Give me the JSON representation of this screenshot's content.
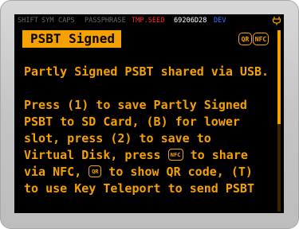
{
  "status_bar": {
    "shift": "SHIFT",
    "sym": "SYM",
    "caps": "CAPS",
    "passphrase": "PASSPHRASE",
    "tmp_seed": "TMP.SEED",
    "fingerprint": "69206D28",
    "dev": "DEV",
    "battery_icon": "battery-plug-icon"
  },
  "title_bar": {
    "title": "PSBT Signed",
    "qr_chip": "QR",
    "nfc_chip": "NFC"
  },
  "message": {
    "line1": "Partly Signed PSBT shared via USB.",
    "line2": "Press (1) to save Partly Signed",
    "line3": "PSBT to SD Card, (B) for lower",
    "line4": "slot, press (2) to save to",
    "line5a": "Virtual Disk, press ",
    "line5_chip": "NFC",
    "line5b": " to share",
    "line6a": "via NFC, ",
    "line6_chip": "QR",
    "line6b": " to show QR code, (T)",
    "line7": "to use Key Teleport to send PSBT"
  },
  "colors": {
    "accent": "#f5a100",
    "screen_bg": "#000000",
    "active_red": "#ff2a2a",
    "dev_blue": "#2f78ff",
    "inactive_gray": "#6a6a6a"
  }
}
